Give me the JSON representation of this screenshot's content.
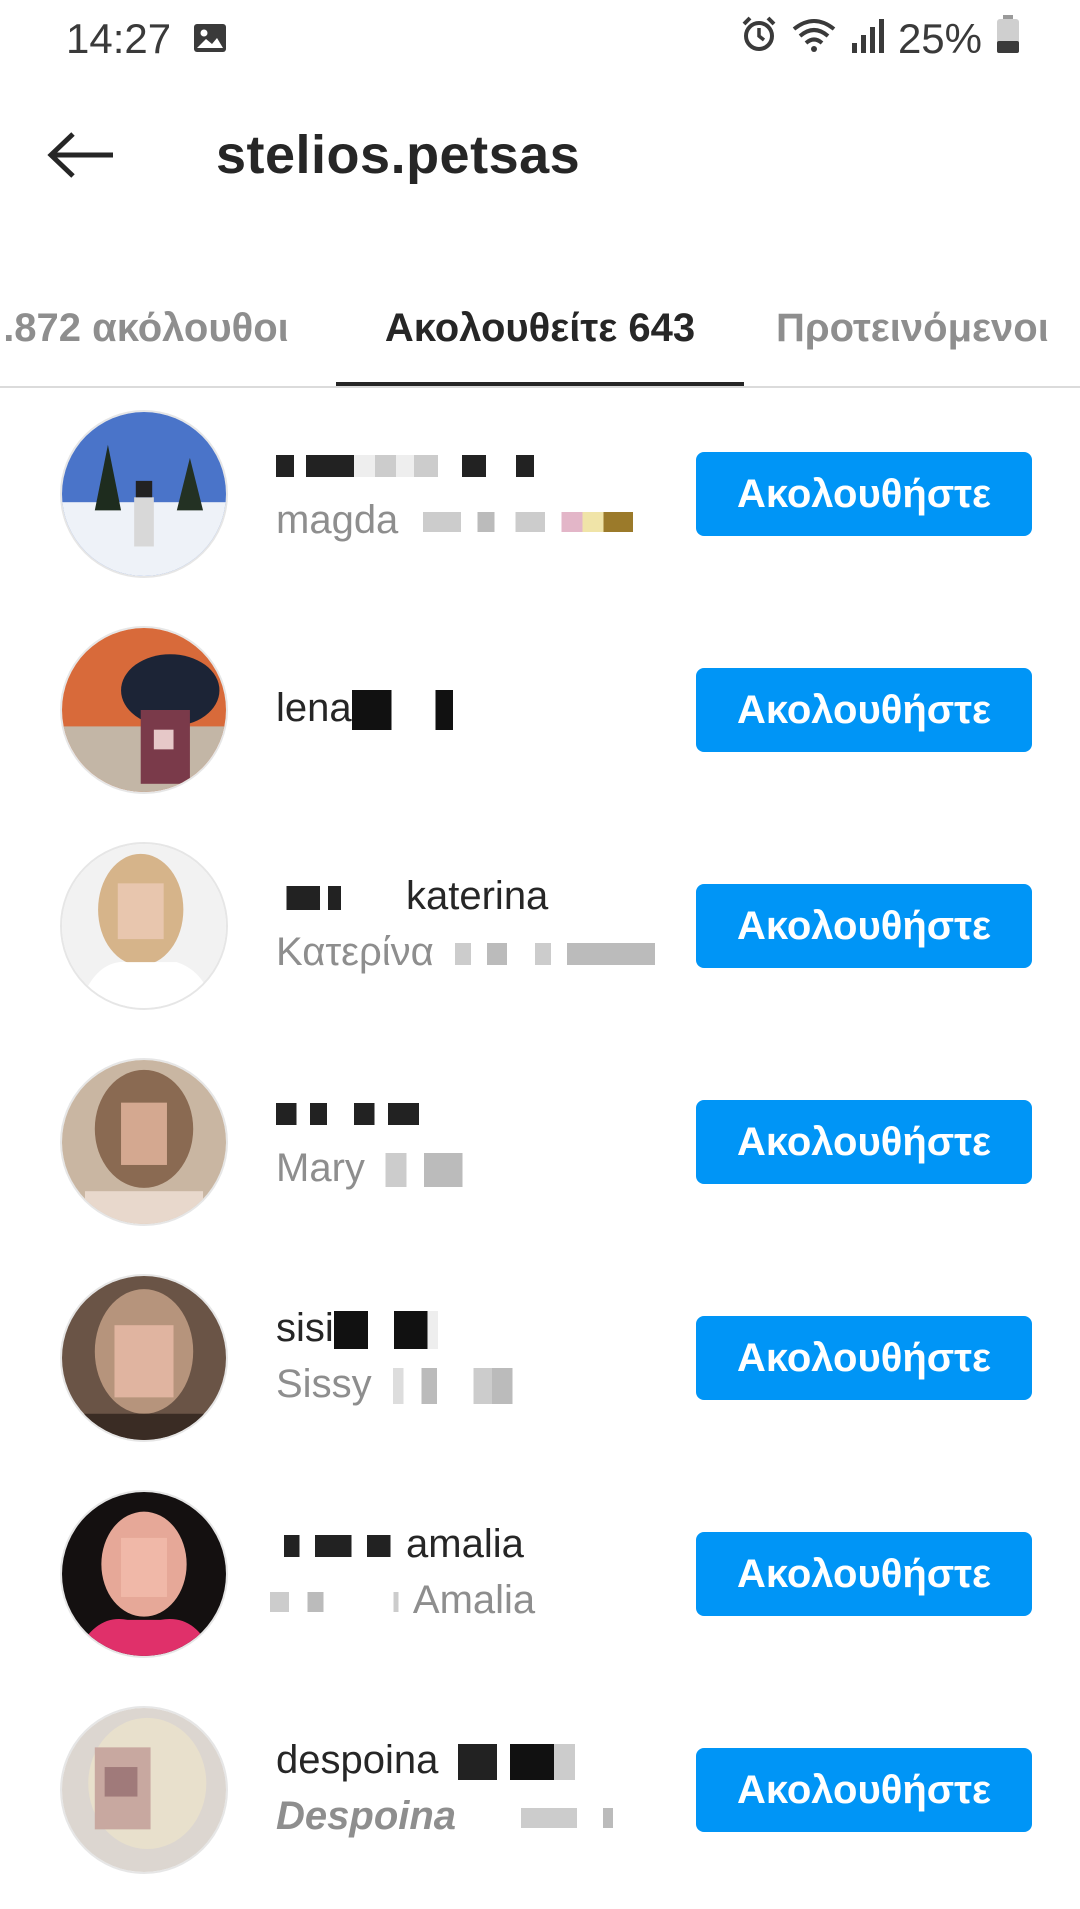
{
  "status_bar": {
    "time": "14:27",
    "battery": "25%",
    "icons": [
      "gallery-icon",
      "alarm-icon",
      "wifi-icon",
      "signal-icon",
      "battery-icon"
    ]
  },
  "header": {
    "back_icon": "back-arrow-icon",
    "title": "stelios.petsas"
  },
  "tabs": [
    {
      "label": ".872 ακόλουθοι",
      "active": false
    },
    {
      "label": "Ακολουθείτε 643",
      "active": true
    },
    {
      "label": "Προτεινόμενοι",
      "active": false
    }
  ],
  "users": [
    {
      "username": "",
      "full_name": "magda",
      "button": "Ακολουθήστε"
    },
    {
      "username": "lena",
      "full_name": "",
      "button": "Ακολουθήστε"
    },
    {
      "username": "katerina",
      "full_name": "Κατερίνα",
      "button": "Ακολουθήστε"
    },
    {
      "username": "",
      "full_name": "Mary",
      "button": "Ακολουθήστε"
    },
    {
      "username": "sisi",
      "full_name": "Sissy",
      "button": "Ακολουθήστε"
    },
    {
      "username": "amalia",
      "full_name": "Amalia",
      "button": "Ακολουθήστε"
    },
    {
      "username": "despoina",
      "full_name": "Despoina",
      "button": "Ακολουθήστε"
    }
  ],
  "colors": {
    "accent": "#0095f6",
    "text_primary": "#262626",
    "text_secondary": "#8e8e8e",
    "divider": "#dbdbdb"
  }
}
